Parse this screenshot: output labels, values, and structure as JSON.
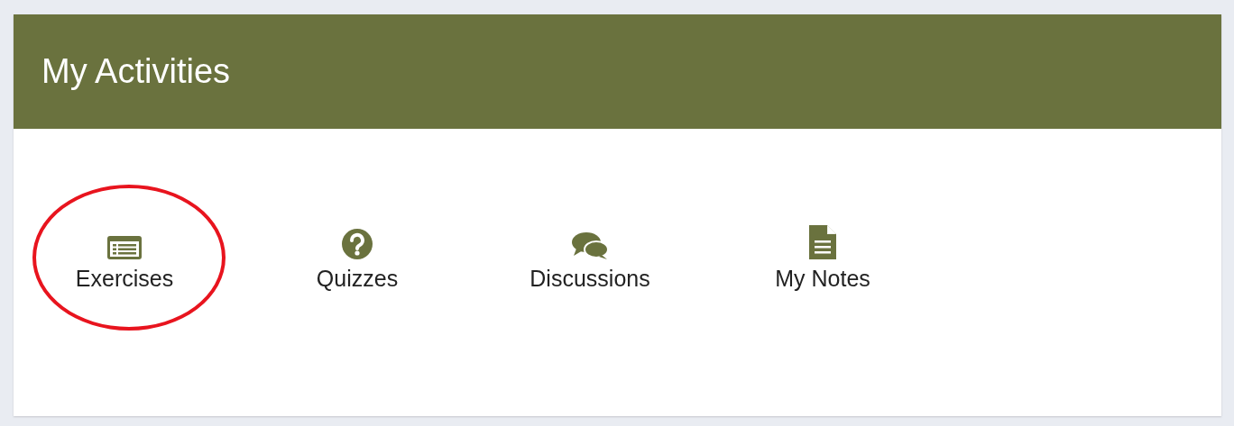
{
  "panel": {
    "title": "My Activities"
  },
  "activities": [
    {
      "kind": "exercises",
      "label": "Exercises",
      "circled": true
    },
    {
      "kind": "quizzes",
      "label": "Quizzes",
      "circled": false
    },
    {
      "kind": "discussions",
      "label": "Discussions",
      "circled": false
    },
    {
      "kind": "notes",
      "label": "My Notes",
      "circled": false
    }
  ]
}
